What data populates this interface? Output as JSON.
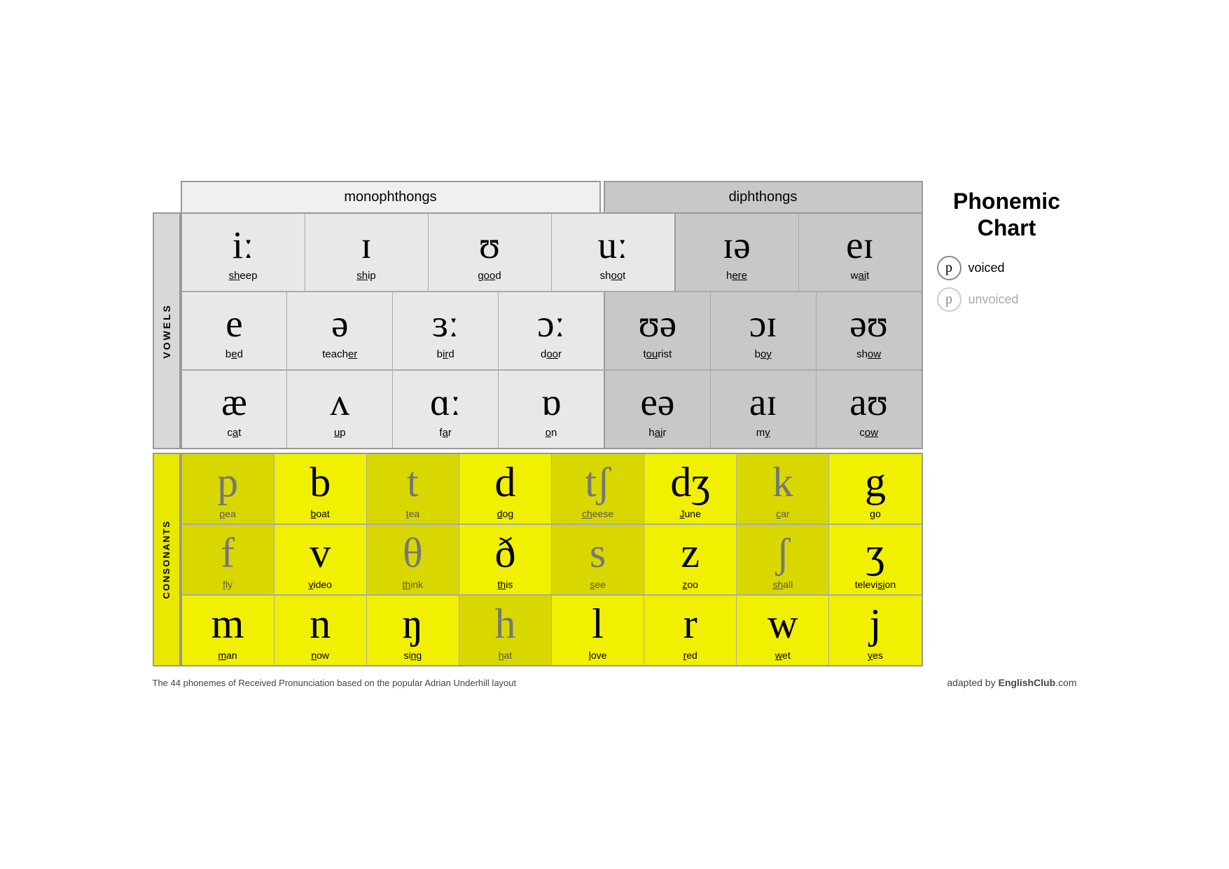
{
  "title": "Phonemic\nChart",
  "legend": {
    "voiced_label": "voiced",
    "unvoiced_label": "unvoiced"
  },
  "header": {
    "monophthongs": "monophthongs",
    "diphthongs": "diphthongs"
  },
  "labels": {
    "vowels": "VOWELS",
    "consonants": "CONSONANTS"
  },
  "vowel_rows": [
    {
      "cells": [
        {
          "symbol": "iː",
          "word": "sheep",
          "underline": "sh",
          "type": "monophthong"
        },
        {
          "symbol": "ɪ",
          "word": "ship",
          "underline": "sh",
          "type": "monophthong"
        },
        {
          "symbol": "ʊ",
          "word": "good",
          "underline": "oo",
          "type": "monophthong"
        },
        {
          "symbol": "uː",
          "word": "shoot",
          "underline": "oo",
          "type": "monophthong"
        },
        {
          "symbol": "ɪə",
          "word": "here",
          "underline": "ere",
          "type": "diphthong"
        },
        {
          "symbol": "eɪ",
          "word": "wait",
          "underline": "ai",
          "type": "diphthong"
        }
      ]
    },
    {
      "cells": [
        {
          "symbol": "e",
          "word": "bed",
          "underline": "e",
          "type": "monophthong"
        },
        {
          "symbol": "ə",
          "word": "teacher",
          "underline": "er",
          "type": "monophthong"
        },
        {
          "symbol": "ɜː",
          "word": "bird",
          "underline": "ir",
          "type": "monophthong"
        },
        {
          "symbol": "ɔː",
          "word": "door",
          "underline": "oo",
          "type": "monophthong"
        },
        {
          "symbol": "ʊə",
          "word": "tourist",
          "underline": "ou",
          "type": "diphthong"
        },
        {
          "symbol": "ɔɪ",
          "word": "boy",
          "underline": "oy",
          "type": "diphthong"
        },
        {
          "symbol": "əʊ",
          "word": "show",
          "underline": "ow",
          "type": "diphthong"
        }
      ]
    },
    {
      "cells": [
        {
          "symbol": "æ",
          "word": "cat",
          "underline": "a",
          "type": "monophthong"
        },
        {
          "symbol": "ʌ",
          "word": "up",
          "underline": "u",
          "type": "monophthong"
        },
        {
          "symbol": "ɑː",
          "word": "far",
          "underline": "a",
          "type": "monophthong"
        },
        {
          "symbol": "ɒ",
          "word": "on",
          "underline": "o",
          "type": "monophthong"
        },
        {
          "symbol": "eə",
          "word": "hair",
          "underline": "ai",
          "type": "diphthong"
        },
        {
          "symbol": "aɪ",
          "word": "my",
          "underline": "y",
          "type": "diphthong"
        },
        {
          "symbol": "aʊ",
          "word": "cow",
          "underline": "ow",
          "type": "diphthong"
        }
      ]
    }
  ],
  "consonant_rows": [
    {
      "cells": [
        {
          "symbol": "p",
          "word": "pea",
          "underline": "p",
          "voicing": "unvoiced"
        },
        {
          "symbol": "b",
          "word": "boat",
          "underline": "b",
          "voicing": "voiced"
        },
        {
          "symbol": "t",
          "word": "tea",
          "underline": "t",
          "voicing": "unvoiced"
        },
        {
          "symbol": "d",
          "word": "dog",
          "underline": "d",
          "voicing": "voiced"
        },
        {
          "symbol": "tʃ",
          "word": "cheese",
          "underline": "ch",
          "voicing": "unvoiced"
        },
        {
          "symbol": "dʒ",
          "word": "June",
          "underline": "J",
          "voicing": "voiced"
        },
        {
          "symbol": "k",
          "word": "car",
          "underline": "c",
          "voicing": "unvoiced"
        },
        {
          "symbol": "g",
          "word": "go",
          "underline": "g",
          "voicing": "voiced"
        }
      ]
    },
    {
      "cells": [
        {
          "symbol": "f",
          "word": "fly",
          "underline": "f",
          "voicing": "unvoiced"
        },
        {
          "symbol": "v",
          "word": "video",
          "underline": "v",
          "voicing": "voiced"
        },
        {
          "symbol": "θ",
          "word": "think",
          "underline": "th",
          "voicing": "unvoiced"
        },
        {
          "symbol": "ð",
          "word": "this",
          "underline": "th",
          "voicing": "voiced"
        },
        {
          "symbol": "s",
          "word": "see",
          "underline": "s",
          "voicing": "unvoiced"
        },
        {
          "symbol": "z",
          "word": "zoo",
          "underline": "z",
          "voicing": "voiced"
        },
        {
          "symbol": "ʃ",
          "word": "shall",
          "underline": "sh",
          "voicing": "unvoiced"
        },
        {
          "symbol": "ʒ",
          "word": "television",
          "underline": "si",
          "voicing": "voiced"
        }
      ]
    },
    {
      "cells": [
        {
          "symbol": "m",
          "word": "man",
          "underline": "m",
          "voicing": "voiced"
        },
        {
          "symbol": "n",
          "word": "now",
          "underline": "n",
          "voicing": "voiced"
        },
        {
          "symbol": "ŋ",
          "word": "sing",
          "underline": "ng",
          "voicing": "voiced"
        },
        {
          "symbol": "h",
          "word": "hat",
          "underline": "h",
          "voicing": "unvoiced"
        },
        {
          "symbol": "l",
          "word": "love",
          "underline": "l",
          "voicing": "voiced"
        },
        {
          "symbol": "r",
          "word": "red",
          "underline": "r",
          "voicing": "voiced"
        },
        {
          "symbol": "w",
          "word": "wet",
          "underline": "w",
          "voicing": "voiced"
        },
        {
          "symbol": "j",
          "word": "yes",
          "underline": "y",
          "voicing": "voiced"
        }
      ]
    }
  ],
  "footer": {
    "note": "The 44 phonemes of Received Pronunciation based on the popular Adrian Underhill layout",
    "credit_prefix": "adapted by ",
    "credit_brand": "EnglishClub",
    "credit_suffix": ".com"
  }
}
